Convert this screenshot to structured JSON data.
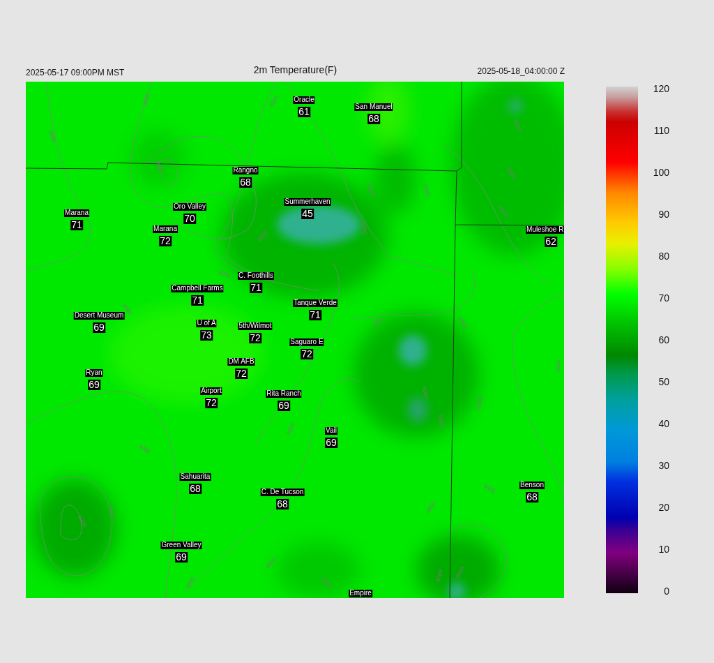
{
  "header": {
    "valid_time": "2025-05-17 09:00PM MST",
    "title": "2m Temperature(F)",
    "model_time": "2025-05-18_04:00:00 Z"
  },
  "stations": [
    {
      "name": "Oracle",
      "value": "61"
    },
    {
      "name": "San Manuel",
      "value": "68"
    },
    {
      "name": "Rangno",
      "value": "68"
    },
    {
      "name": "Summerhaven",
      "value": "45"
    },
    {
      "name": "Marana",
      "value": "71"
    },
    {
      "name": "Oro Valley",
      "value": "70"
    },
    {
      "name": "Marana",
      "value": "72"
    },
    {
      "name": "Muleshoe R",
      "value": "62"
    },
    {
      "name": "C. Foothills",
      "value": "71"
    },
    {
      "name": "Campbell Farms",
      "value": "71"
    },
    {
      "name": "Tanque Verde",
      "value": "71"
    },
    {
      "name": "Desert Museum",
      "value": "69"
    },
    {
      "name": "U of A",
      "value": "73"
    },
    {
      "name": "5th/Wilmot",
      "value": "72"
    },
    {
      "name": "Saguaro E",
      "value": "72"
    },
    {
      "name": "DM AFB",
      "value": "72"
    },
    {
      "name": "Ryan",
      "value": "69"
    },
    {
      "name": "Airport",
      "value": "72"
    },
    {
      "name": "Rita Ranch",
      "value": "69"
    },
    {
      "name": "Vail",
      "value": "69"
    },
    {
      "name": "Sahuarita",
      "value": "68"
    },
    {
      "name": "Benson",
      "value": "68"
    },
    {
      "name": "C. De Tucson",
      "value": "68"
    },
    {
      "name": "Green Valley",
      "value": "69"
    },
    {
      "name": "Empire"
    }
  ],
  "contour_labels": [
    "3000",
    "4000",
    "2000",
    "4000",
    "6000",
    "3000",
    "3000",
    "6000",
    "4000",
    "3000",
    "5000",
    "4000",
    "5000",
    "4000",
    "4000",
    "3000",
    "3000",
    "4000",
    "5000",
    "4000",
    "3000",
    "6000",
    "5000",
    "5000",
    "4000",
    "4000",
    "4000",
    "5000",
    "5000",
    "6000"
  ],
  "colorbar": {
    "ticks": [
      "120",
      "110",
      "100",
      "90",
      "80",
      "70",
      "60",
      "50",
      "40",
      "30",
      "20",
      "10",
      "0"
    ]
  }
}
